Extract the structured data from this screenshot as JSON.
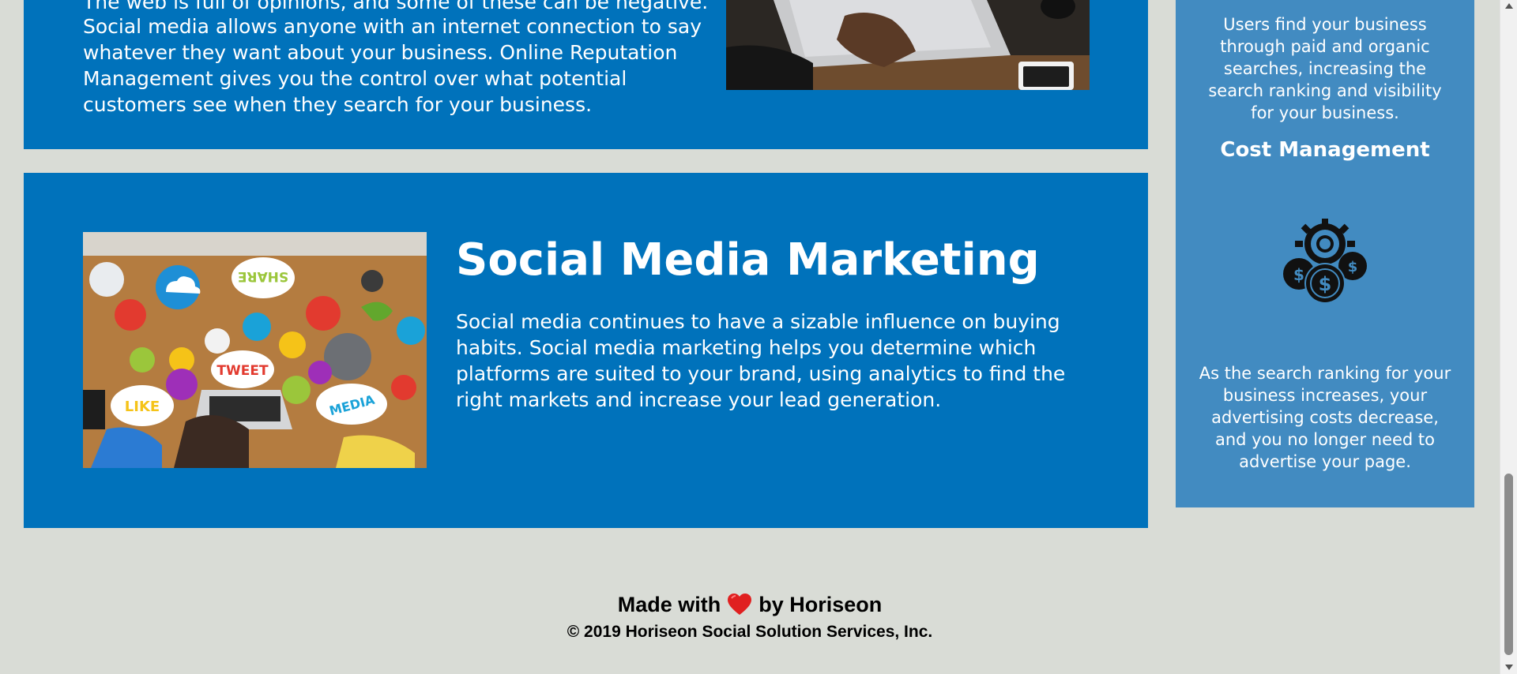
{
  "reputation": {
    "partial_first_line": "The web is full of opinions, and some of these can be negative.",
    "body": "Social media allows anyone with an internet connection to say whatever they want about your business. Online Reputation Management gives you the control over what potential customers see when they search for your business."
  },
  "social_media_marketing": {
    "title": "Social Media Marketing",
    "body": "Social media continues to have a sizable influence on buying habits. Social media marketing helps you determine which platforms are suited to your brand, using analytics to find the right markets and increase your lead generation.",
    "image_words": [
      "SHARE",
      "TWEET",
      "LIKE",
      "MEDIA"
    ]
  },
  "sidebar": {
    "lead_generation_text": "Users find your business through paid and organic searches, increasing the search ranking and visibility for your business.",
    "cost_management": {
      "title": "Cost Management",
      "icon": "cost-management-icon",
      "text": "As the search ranking for your business increases, your advertising costs decrease, and you no longer need to advertise your page."
    }
  },
  "footer": {
    "made_with": "Made with",
    "by": "by Horiseon",
    "heart_icon": "heart-icon",
    "copyright": "© 2019 Horiseon Social Solution Services, Inc."
  },
  "colors": {
    "page_background": "#d9dcd6",
    "card_blue": "#0072bb",
    "sidebar_blue": "#428bc1",
    "heart_red": "#e02020"
  }
}
